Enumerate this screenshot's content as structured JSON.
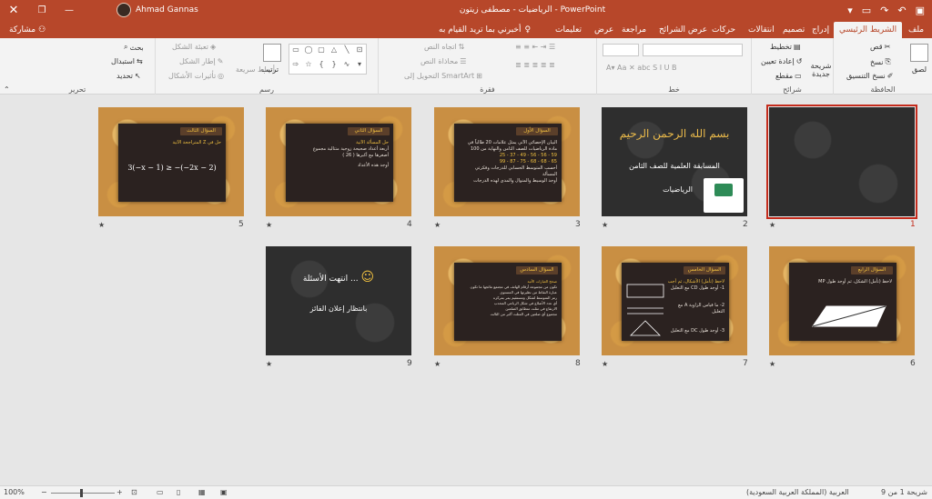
{
  "titlebar": {
    "doc_title": "الرياضيات - مصطفى زيتون - PowerPoint",
    "user_name": "Ahmad Gannas",
    "close_glyph": "✕",
    "restore_glyph": "❐",
    "minimize_glyph": "—",
    "qat_icons": [
      "save-icon",
      "undo-icon",
      "redo-icon",
      "start-icon",
      "customize-icon"
    ]
  },
  "tabs": {
    "share": "مشاركة",
    "tell_me": "أخبرني بما تريد القيام به",
    "items": [
      "ملف",
      "الشريط الرئيسي",
      "إدراج",
      "تصميم",
      "انتقالات",
      "حركات",
      "عرض الشرائح",
      "مراجعة",
      "عرض",
      "تعليمات"
    ],
    "active": "الشريط الرئيسي"
  },
  "ribbon": {
    "clipboard": {
      "label": "الحافظة",
      "paste": "لصق",
      "cut": "قص",
      "copy": "نسخ",
      "format_painter": "نسخ التنسيق"
    },
    "slides": {
      "label": "شرائح",
      "new_slide": "شريحة جديدة",
      "layout": "تخطيط",
      "reset": "إعادة تعيين",
      "section": "مقطع"
    },
    "font": {
      "label": "خط"
    },
    "paragraph": {
      "label": "فقرة",
      "text_direction": "اتجاه النص",
      "align_text": "محاذاة النص",
      "smartart": "التحويل إلى SmartArt"
    },
    "drawing": {
      "label": "رسم",
      "arrange": "ترتيب",
      "quick_styles": "أنماط سريعة",
      "shape_fill": "تعبئة الشكل",
      "shape_outline": "إطار الشكل",
      "shape_effects": "تأثيرات الأشكال"
    },
    "editing": {
      "label": "تحرير",
      "find": "بحث",
      "replace": "استبدال",
      "select": "تحديد"
    }
  },
  "slides": [
    {
      "num": "1",
      "type": "blank-dark"
    },
    {
      "num": "2",
      "title": "بسم الله الرحمن الرحيم",
      "line1": "المسابقة العلمية للصف الثامن",
      "line2": "الرياضيات"
    },
    {
      "num": "3",
      "header": "السؤال الأول",
      "body": [
        "البيان الإحصائي الآتي يمثل علامات 20 طالباً في",
        "مادة الرياضيات للصف الثامن والنهاية من 100",
        "59 - 56 - 56 - 49 - 37 - 25",
        "65 - 68 - 68 - 75 - 87 - 99",
        "أحسب المتوسط الحسابي للدرجات وفكرتي المسألة",
        "أوجد الوسيط والمنوال والمدى لهذه الدرجات"
      ]
    },
    {
      "num": "4",
      "header": "السؤال الثاني",
      "body": [
        "حل المسألة الآتية",
        "أربعة أعداد صحيحة زوجية متتالية مجموع",
        "أصغرها مع أكبرها ( 26 )",
        "أوجد هذه الأعداد"
      ]
    },
    {
      "num": "5",
      "header": "السؤال الثالث",
      "body": [
        "حل في Z المتراجحة الآتية"
      ],
      "formula": "3(−x − 1) ≥ −(−2x − 2)"
    },
    {
      "num": "6",
      "header": "السؤال الرابع",
      "body": [
        "لاحظ (تأمل) الشكل، ثم أوجد طول MP"
      ]
    },
    {
      "num": "7",
      "header": "السؤال الخامس",
      "body": [
        "لاحظ (تأمل) الأشكال، ثم أجب",
        "1- أوجد طول CD مع التعليل",
        "2- ما قياس الزاوية A مع التعليل",
        "3- أوجد طول DC مع التعليل"
      ]
    },
    {
      "num": "8",
      "header": "السؤال السادس",
      "body": [
        "صحح العبارات الآتية",
        "تكون من مجموعة أرقام الهاتف في مجتمع نتائجها ما تكون",
        "عبارة النقاط من نظيرتها في المستوى",
        "رمز المتوسط لشكل ومستقيم يمر بمركزه",
        "أي عدد الأضلاع في شكل الرباعي المحدب",
        "الارتفاع في مثلث متطابق الضلعين",
        "مجموع أي ضلعين في المثلث أكبر من الثالث"
      ]
    },
    {
      "num": "9",
      "title": "انتهت الأسئلة ...",
      "smile": "☺",
      "sub": "بانتظار إعلان الفائز"
    }
  ],
  "status": {
    "slide_info": "شريحة 1 من 9",
    "language": "العربية (المملكة العربية السعودية)",
    "zoom": "100%",
    "zoom_minus": "−",
    "zoom_plus": "+"
  },
  "colors": {
    "accent": "#b7472a",
    "selection": "#c42b1c",
    "board": "#2b2220",
    "gold": "#c98f43",
    "highlight": "#f0c040"
  }
}
